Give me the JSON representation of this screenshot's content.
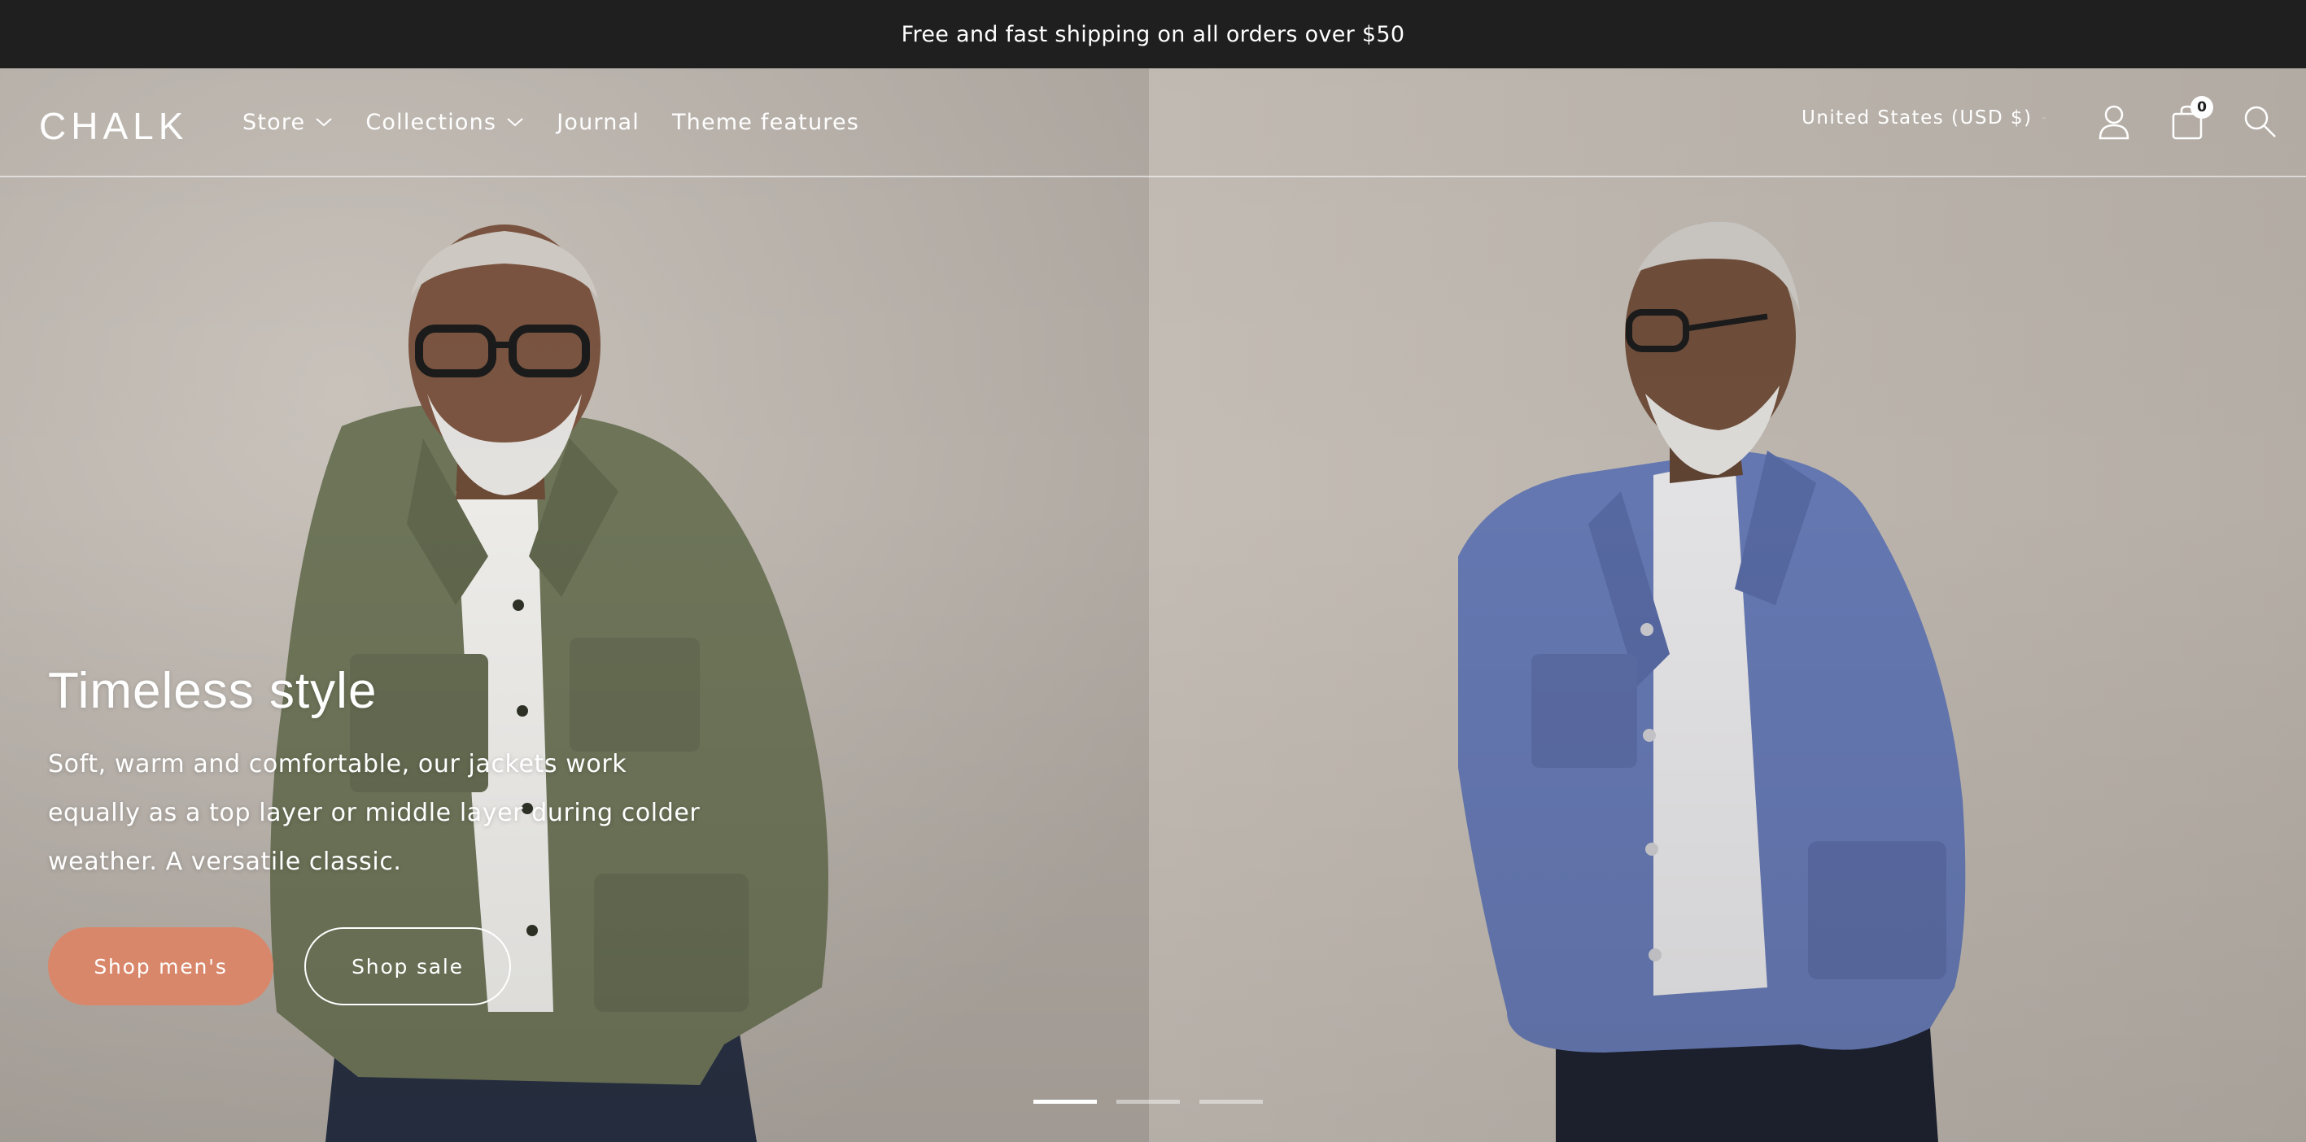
{
  "announcement": {
    "text": "Free and fast shipping on all orders over $50"
  },
  "header": {
    "logo": "CHALK",
    "nav": [
      {
        "label": "Store",
        "has_dropdown": true
      },
      {
        "label": "Collections",
        "has_dropdown": true
      },
      {
        "label": "Journal",
        "has_dropdown": false
      },
      {
        "label": "Theme features",
        "has_dropdown": false
      }
    ],
    "country_selector": "United States (USD $)",
    "cart_count": "0",
    "icons": [
      "account-icon",
      "cart-icon",
      "search-icon"
    ]
  },
  "hero": {
    "title": "Timeless style",
    "text": "Soft, warm and comfortable, our jackets work equally as a top layer or middle layer during colder weather. A versatile classic.",
    "buttons": {
      "primary": "Shop men's",
      "secondary": "Shop sale"
    },
    "slides_total": 3,
    "active_slide": 1
  },
  "colors": {
    "announcement_bg": "#1f1f1f",
    "primary_button": "#d9876a",
    "text_on_image": "#ffffff"
  }
}
